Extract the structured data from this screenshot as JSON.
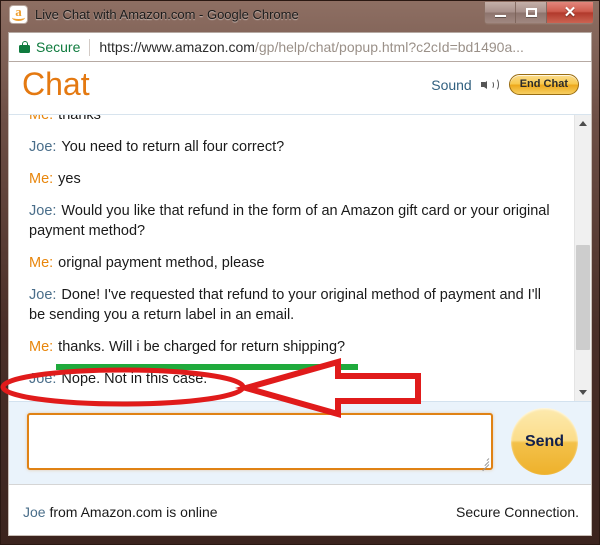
{
  "window": {
    "title": "Live Chat with Amazon.com - Google Chrome",
    "favicon_letter": "a",
    "controls": {
      "minimize_label": "–",
      "maximize_label": "□",
      "close_label": "✕"
    }
  },
  "omnibox": {
    "security_label": "Secure",
    "url_host": "https://www.amazon.com",
    "url_path": "/gp/help/chat/popup.html?c2cId=bd1490a..."
  },
  "chat": {
    "title": "Chat",
    "sound_label": "Sound",
    "end_chat_label": "End Chat",
    "messages": [
      {
        "who": "Me:",
        "role": "me",
        "text": "thanks"
      },
      {
        "who": "Joe:",
        "role": "joe",
        "text": "You need to return all four correct?"
      },
      {
        "who": "Me:",
        "role": "me",
        "text": "yes"
      },
      {
        "who": "Joe:",
        "role": "joe",
        "text": "Would you like that refund in the form of an Amazon gift card or your original payment method?"
      },
      {
        "who": "Me:",
        "role": "me",
        "text": "orignal payment method, please"
      },
      {
        "who": "Joe:",
        "role": "joe",
        "text": "Done! I've requested that refund to your original method of payment and I'll be sending you a return label in an email."
      },
      {
        "who": "Me:",
        "role": "me",
        "text": "thanks. Will i be charged for return shipping?"
      },
      {
        "who": "Joe:",
        "role": "joe",
        "text": "Nope. Not in this case."
      }
    ]
  },
  "compose": {
    "input_value": "",
    "input_placeholder": "",
    "send_label": "Send"
  },
  "footer": {
    "agent_name": "Joe",
    "status_text": " from Amazon.com is online",
    "connection_text": "Secure Connection."
  },
  "annotations": {
    "highlight_color": "#1faa3c",
    "markup_color": "#e01b1b",
    "arrow_fill": "#ffffff"
  },
  "colors": {
    "amazon_orange": "#e47911",
    "me_name": "#e8860c",
    "joe_name": "#4a6e8a",
    "secure_green": "#0f7b3e",
    "compose_bg": "#eaf3fb",
    "send_gold": "#f3c14a"
  }
}
